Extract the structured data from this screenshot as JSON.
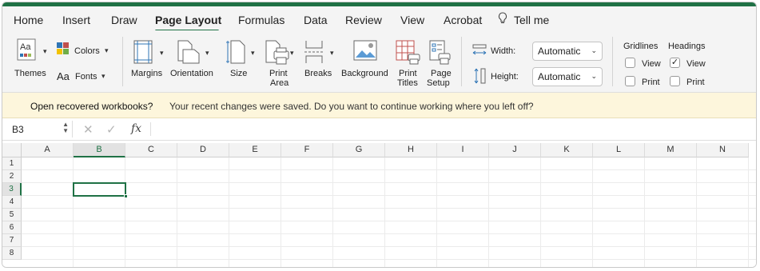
{
  "tabs": [
    {
      "label": "Home"
    },
    {
      "label": "Insert"
    },
    {
      "label": "Draw"
    },
    {
      "label": "Page Layout",
      "active": true
    },
    {
      "label": "Formulas"
    },
    {
      "label": "Data"
    },
    {
      "label": "Review"
    },
    {
      "label": "View"
    },
    {
      "label": "Acrobat"
    }
  ],
  "tell_me": "Tell me",
  "ribbon": {
    "themes": "Themes",
    "colors": "Colors",
    "fonts": "Fonts",
    "margins": "Margins",
    "orientation": "Orientation",
    "size": "Size",
    "print_area_1": "Print",
    "print_area_2": "Area",
    "breaks": "Breaks",
    "background": "Background",
    "print_titles_1": "Print",
    "print_titles_2": "Titles",
    "page_setup_1": "Page",
    "page_setup_2": "Setup",
    "width_label": "Width:",
    "width_value": "Automatic",
    "height_label": "Height:",
    "height_value": "Automatic",
    "gridlines": "Gridlines",
    "headings": "Headings",
    "gridlines_view": "View",
    "gridlines_print": "Print",
    "headings_view": "View",
    "headings_print": "Print",
    "gridlines_view_checked": false,
    "gridlines_print_checked": false,
    "headings_view_checked": true,
    "headings_print_checked": false
  },
  "notification": {
    "title": "Open recovered workbooks?",
    "message": "Your recent changes were saved. Do you want to continue working where you left off?"
  },
  "formula_bar": {
    "name_box": "B3",
    "cancel_glyph": "✕",
    "enter_glyph": "✓",
    "fx": "fx",
    "formula": ""
  },
  "grid": {
    "columns": [
      "A",
      "B",
      "C",
      "D",
      "E",
      "F",
      "G",
      "H",
      "I",
      "J",
      "K",
      "L",
      "M",
      "N"
    ],
    "rows": [
      "1",
      "2",
      "3",
      "4",
      "5",
      "6",
      "7",
      "8"
    ],
    "selected_column": "B",
    "selected_row": "3"
  },
  "colors": {
    "accent": "#1f7145",
    "notification_bg": "#fdf6dc"
  }
}
